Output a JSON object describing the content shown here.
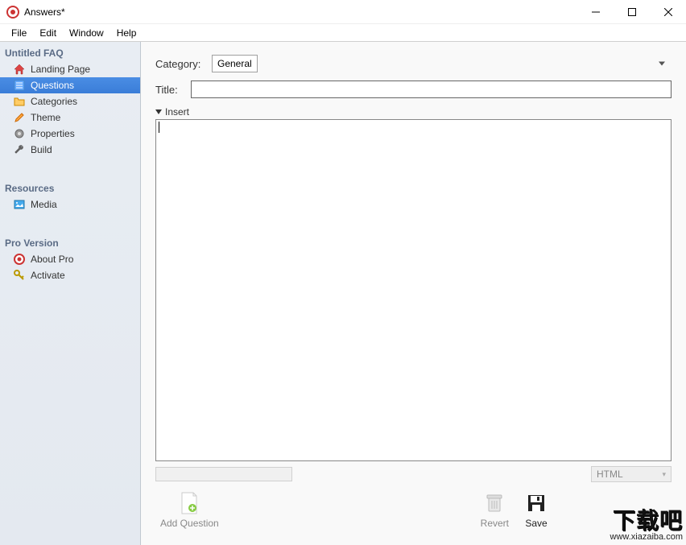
{
  "window": {
    "title": "Answers*"
  },
  "menubar": {
    "items": [
      "File",
      "Edit",
      "Window",
      "Help"
    ]
  },
  "sidebar": {
    "sections": [
      {
        "header": "Untitled FAQ",
        "items": [
          {
            "id": "landing-page",
            "label": "Landing Page",
            "icon": "house-icon",
            "selected": false
          },
          {
            "id": "questions",
            "label": "Questions",
            "icon": "list-icon",
            "selected": true
          },
          {
            "id": "categories",
            "label": "Categories",
            "icon": "folder-icon",
            "selected": false
          },
          {
            "id": "theme",
            "label": "Theme",
            "icon": "pencil-icon",
            "selected": false
          },
          {
            "id": "properties",
            "label": "Properties",
            "icon": "gear-icon",
            "selected": false
          },
          {
            "id": "build",
            "label": "Build",
            "icon": "wrench-icon",
            "selected": false
          }
        ]
      },
      {
        "header": "Resources",
        "items": [
          {
            "id": "media",
            "label": "Media",
            "icon": "image-icon",
            "selected": false
          }
        ]
      },
      {
        "header": "Pro Version",
        "items": [
          {
            "id": "about-pro",
            "label": "About Pro",
            "icon": "lifebuoy-icon",
            "selected": false
          },
          {
            "id": "activate",
            "label": "Activate",
            "icon": "key-icon",
            "selected": false
          }
        ]
      }
    ]
  },
  "form": {
    "category_label": "Category:",
    "category_value": "General",
    "title_label": "Title:",
    "title_value": "",
    "insert_label": "Insert",
    "editor_value": ""
  },
  "statusbar": {
    "mode": "HTML"
  },
  "bottom_toolbar": {
    "add_question": "Add Question",
    "revert": "Revert",
    "save": "Save"
  },
  "watermark": {
    "big": "下载吧",
    "small": "www.xiazaiba.com"
  }
}
